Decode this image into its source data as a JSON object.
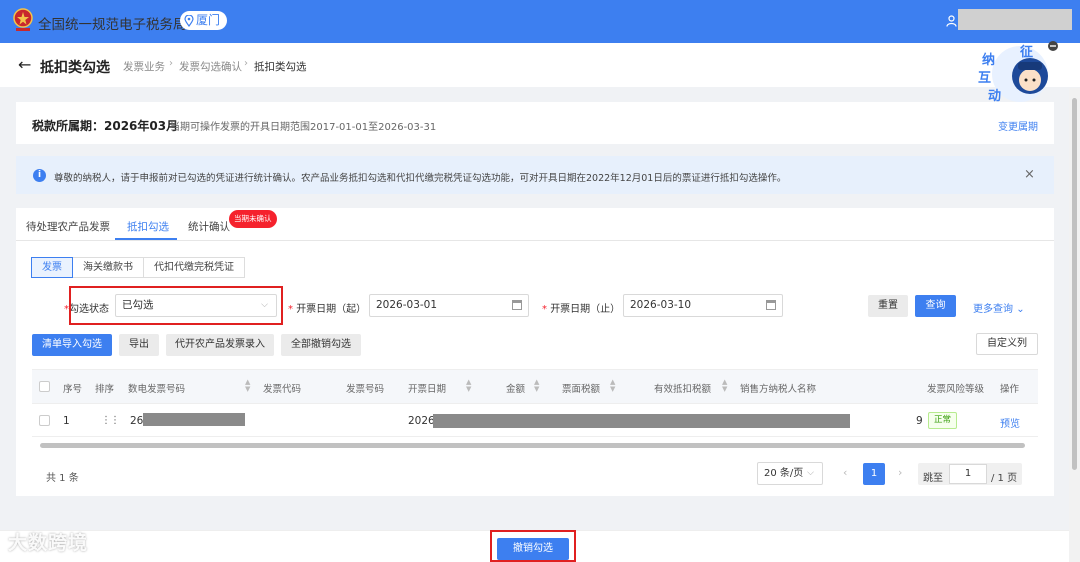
{
  "header": {
    "app_title": "全国统一规范电子税务局",
    "location": "厦门"
  },
  "subheader": {
    "page_title": "抵扣类勾选",
    "breadcrumbs": [
      "发票业务",
      "发票勾选确认",
      "抵扣类勾选"
    ]
  },
  "mascot": {
    "chars": [
      "征",
      "纳",
      "互",
      "动"
    ]
  },
  "period": {
    "label": "税款所属期：2026年03月",
    "range_text": "当期可操作发票的开具日期范围2017-01-01至2026-03-31",
    "change_link": "变更属期"
  },
  "alert": {
    "icon": "info-icon",
    "text": "尊敬的纳税人，请于申报前对已勾选的凭证进行统计确认。农产品业务抵扣勾选和代扣代缴完税凭证勾选功能，可对开具日期在2022年12月01日后的票证进行抵扣勾选操作。",
    "close": "×"
  },
  "tabs": [
    {
      "label": "待处理农产品发票"
    },
    {
      "label": "抵扣勾选"
    },
    {
      "label": "统计确认",
      "badge": "当期未确认"
    }
  ],
  "subtabs": [
    "发票",
    "海关缴款书",
    "代扣代缴完税凭证"
  ],
  "filters": {
    "status_label": "勾选状态",
    "status_value": "已勾选",
    "date_start_label": "开票日期（起）",
    "date_start_value": "2026-03-01",
    "date_end_label": "开票日期（止）",
    "date_end_value": "2026-03-10",
    "reset": "重置",
    "query": "查询",
    "more_query": "更多查询"
  },
  "actions": {
    "import_select": "清单导入勾选",
    "export": "导出",
    "agri_entry": "代开农产品发票录入",
    "cancel_all": "全部撤销勾选",
    "custom_columns": "自定义列"
  },
  "table": {
    "columns": [
      "序号",
      "排序",
      "数电发票号码",
      "发票代码",
      "发票号码",
      "开票日期",
      "金额",
      "票面税额",
      "有效抵扣税额",
      "销售方纳税人名称",
      "发票风险等级",
      "操作"
    ],
    "rows": [
      {
        "index": "1",
        "einvoice_no_prefix": "26",
        "date_prefix": "2026-",
        "seller_suffix": "9",
        "risk": "正常",
        "action": "预览"
      }
    ]
  },
  "pagination": {
    "total": "共 1 条",
    "page_size": "20 条/页",
    "current_page": "1",
    "jump_label": "跳至",
    "jump_value": "1",
    "total_pages": "/ 1 页"
  },
  "footer": {
    "cancel_button": "撤销勾选",
    "watermark": "大数跨境"
  }
}
